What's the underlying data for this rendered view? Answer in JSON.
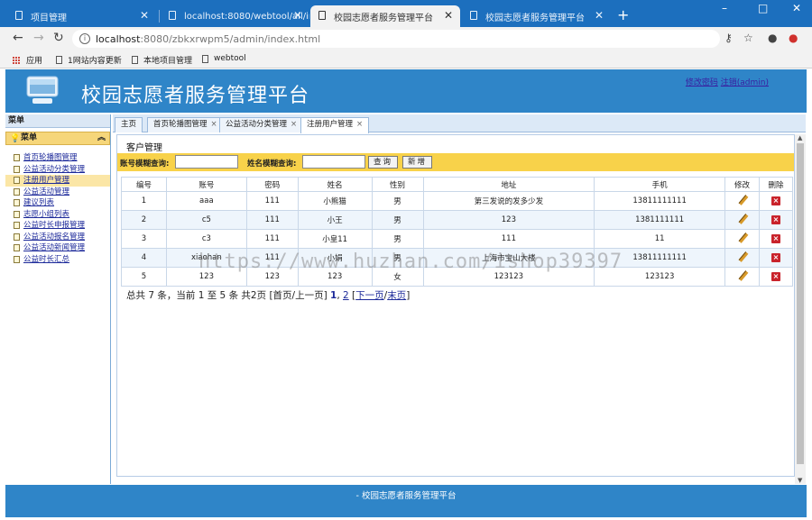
{
  "browser": {
    "tabs": [
      {
        "title": "项目管理",
        "active": false
      },
      {
        "title": "localhost:8080/webtool/all/in",
        "active": false
      },
      {
        "title": "校园志愿者服务管理平台",
        "active": true
      },
      {
        "title": "校园志愿者服务管理平台",
        "active": false
      }
    ],
    "new_tab": "+",
    "address": {
      "host": "localhost",
      "path": ":8080/zbkxrwpm5/admin/index.html"
    },
    "bookmarks": [
      "应用",
      "1网站内容更新",
      "本地项目管理",
      "webtool"
    ],
    "window_controls": [
      "–",
      "□",
      "✕"
    ]
  },
  "header": {
    "title": "校园志愿者服务管理平台",
    "change_password": "修改密码",
    "logout": "注销(admin)"
  },
  "sidebar": {
    "top_label": "菜单",
    "menu_label": "菜单",
    "items": [
      {
        "label": "首页轮播图管理",
        "active": false
      },
      {
        "label": "公益活动分类管理",
        "active": false
      },
      {
        "label": "注册用户管理",
        "active": true
      },
      {
        "label": "公益活动管理",
        "active": false
      },
      {
        "label": "建议列表",
        "active": false
      },
      {
        "label": "志愿小组列表",
        "active": false
      },
      {
        "label": "公益时长申报管理",
        "active": false
      },
      {
        "label": "公益活动报名管理",
        "active": false
      },
      {
        "label": "公益活动新闻管理",
        "active": false
      },
      {
        "label": "公益时长汇总",
        "active": false
      }
    ]
  },
  "content_tabs": [
    {
      "label": "主页",
      "closable": false,
      "active": false
    },
    {
      "label": "首页轮播图管理",
      "closable": true,
      "active": false
    },
    {
      "label": "公益活动分类管理",
      "closable": true,
      "active": false
    },
    {
      "label": "注册用户管理",
      "closable": true,
      "active": true
    }
  ],
  "panel": {
    "title": "客户管理",
    "search": {
      "account_label": "账号模糊查询:",
      "account_value": "",
      "name_label": "姓名模糊查询:",
      "name_value": "",
      "query_button": "查询",
      "add_button": "新增"
    },
    "table": {
      "columns": [
        "编号",
        "账号",
        "密码",
        "姓名",
        "性别",
        "地址",
        "手机",
        "修改",
        "删除"
      ],
      "rows": [
        [
          "1",
          "aaa",
          "111",
          "小熊猫",
          "男",
          "第三发说的发多少发",
          "13811111111"
        ],
        [
          "2",
          "c5",
          "111",
          "小王",
          "男",
          "123",
          "1381111111"
        ],
        [
          "3",
          "c3",
          "111",
          "小皇11",
          "男",
          "111",
          "11"
        ],
        [
          "4",
          "xiaohan",
          "111",
          "小娟",
          "男",
          "上海市宝山大楼",
          "13811111111"
        ],
        [
          "5",
          "123",
          "123",
          "123",
          "女",
          "123123",
          "123123"
        ]
      ]
    },
    "pager": {
      "summary": "总共 7 条，当前 1 至 5 条 共2页",
      "first": "[首页/上一页]",
      "page1": "1",
      "page2": "2",
      "next": "下一页",
      "last": "末页"
    }
  },
  "watermark": "https://www.huzhan.com/ishop39397",
  "footer": {
    "text": "- 校园志愿者服务管理平台"
  },
  "colors": {
    "header": "#2f85c8",
    "search_bar": "#f8d24a",
    "tabstrip": "#1c6fbe"
  }
}
